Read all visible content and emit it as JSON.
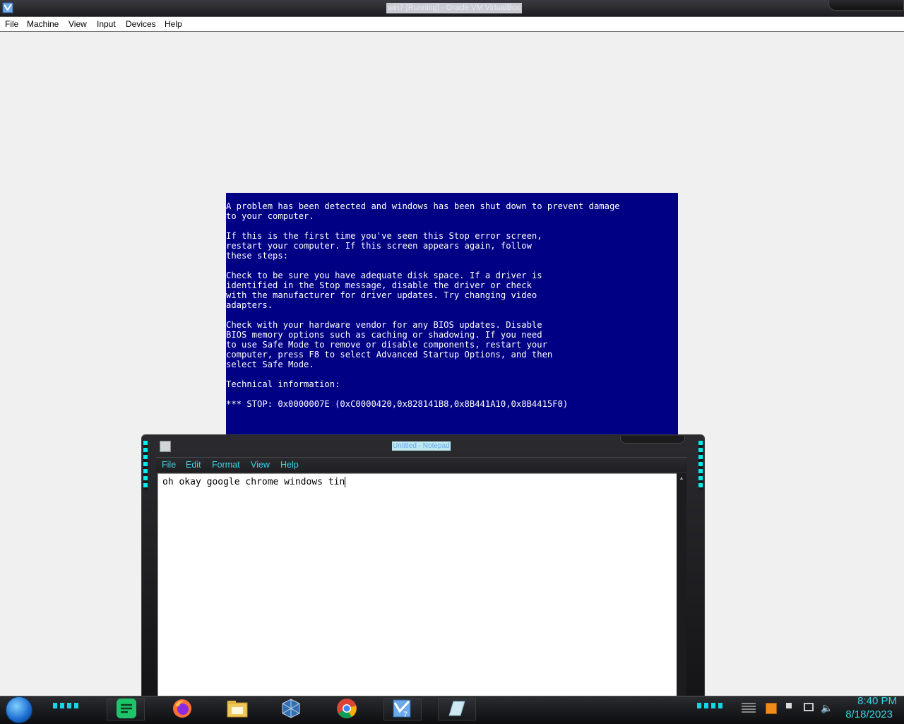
{
  "vbox": {
    "title": "win7 [Running] - Oracle VM VirtualBox",
    "menu": [
      "File",
      "Machine",
      "View",
      "Input",
      "Devices",
      "Help"
    ]
  },
  "bsod": {
    "text": "A problem has been detected and windows has been shut down to prevent damage\nto your computer.\n\nIf this is the first time you've seen this Stop error screen,\nrestart your computer. If this screen appears again, follow\nthese steps:\n\nCheck to be sure you have adequate disk space. If a driver is\nidentified in the Stop message, disable the driver or check\nwith the manufacturer for driver updates. Try changing video\nadapters.\n\nCheck with your hardware vendor for any BIOS updates. Disable\nBIOS memory options such as caching or shadowing. If you need\nto use Safe Mode to remove or disable components, restart your\ncomputer, press F8 to select Advanced Startup Options, and then\nselect Safe Mode.\n\nTechnical information:\n\n*** STOP: 0x0000007E (0xC0000420,0x828141B8,0x8B441A10,0x8B4415F0)"
  },
  "notepad": {
    "title": "Untitled - Notepad",
    "menu": [
      "File",
      "Edit",
      "Format",
      "View",
      "Help"
    ],
    "content": "oh okay google chrome windows tin"
  },
  "taskbar": {
    "apps": [
      "start-orb",
      "notes-app",
      "firefox",
      "file-explorer",
      "virtualbox",
      "chrome",
      "win7-vm",
      "notepad"
    ],
    "clock": {
      "time": "8:40 PM",
      "date": "8/18/2023"
    }
  },
  "colors": {
    "bsod_bg": "#000084",
    "accent": "#3ad3e3"
  }
}
